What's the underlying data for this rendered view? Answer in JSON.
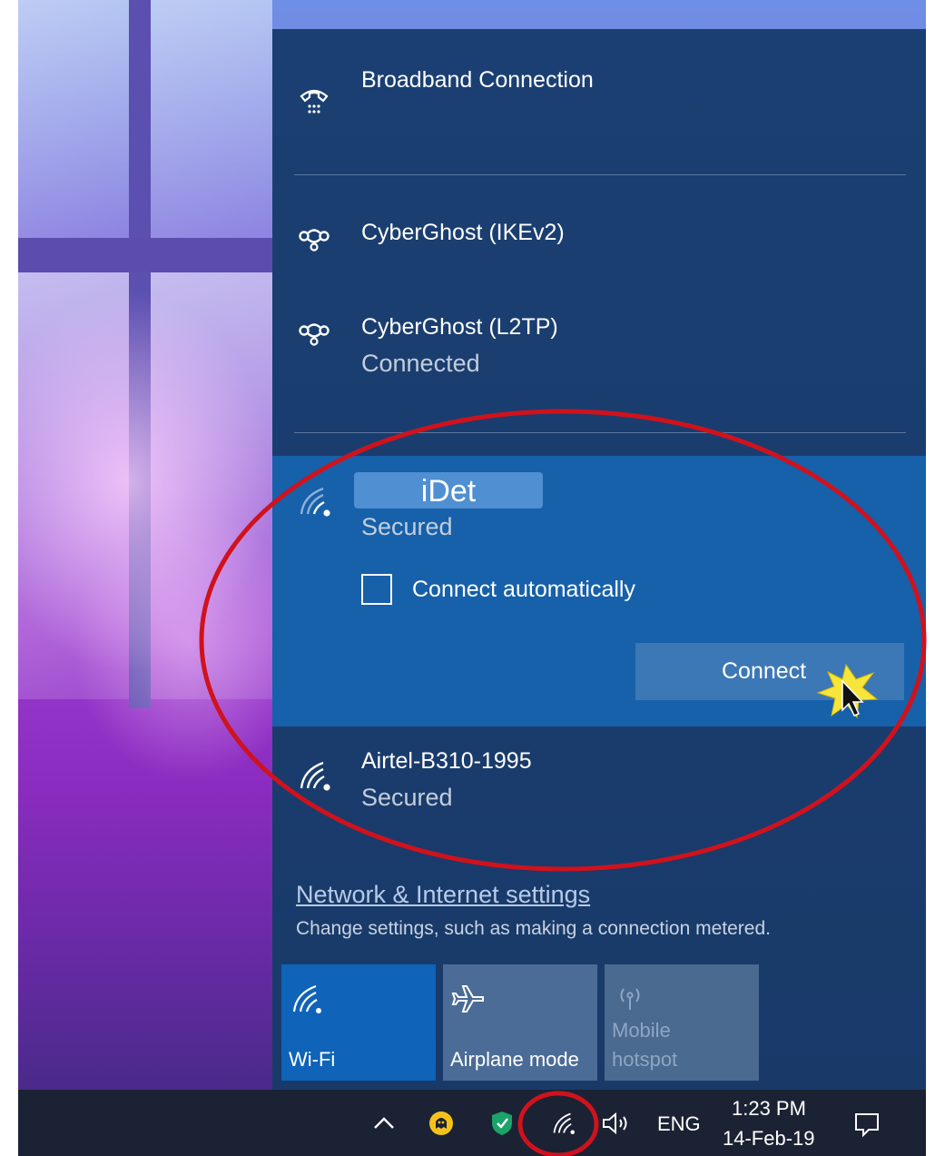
{
  "flyout": {
    "connections": [
      {
        "name": "Broadband Connection",
        "icon": "dialup-icon"
      },
      {
        "name": "CyberGhost (IKEv2)",
        "icon": "vpn-icon"
      },
      {
        "name": "CyberGhost (L2TP)",
        "status": "Connected",
        "icon": "vpn-icon"
      }
    ],
    "selected_network": {
      "name": "iDet",
      "status": "Secured",
      "auto_connect_label": "Connect automatically",
      "auto_connect_checked": false,
      "connect_label": "Connect",
      "icon": "wifi-signal-icon"
    },
    "other_networks": [
      {
        "name": "Airtel-B310-1995",
        "status": "Secured",
        "icon": "wifi-signal-icon"
      }
    ],
    "settings": {
      "link": "Network & Internet settings",
      "description": "Change settings, such as making a connection metered."
    },
    "quick_actions": [
      {
        "label": "Wi-Fi",
        "icon": "wifi-icon",
        "state": "on"
      },
      {
        "label": "Airplane mode",
        "icon": "airplane-icon",
        "state": "off"
      },
      {
        "label_line1": "Mobile",
        "label_line2": "hotspot",
        "icon": "hotspot-icon",
        "state": "disabled"
      }
    ]
  },
  "taskbar": {
    "tray_icons": [
      "chevron-up-icon",
      "cyberghost-icon",
      "security-shield-icon",
      "wifi-icon",
      "speaker-icon"
    ],
    "language": "ENG",
    "time": "1:23 PM",
    "date": "14-Feb-19",
    "action_center_icon": "notification-icon"
  },
  "colors": {
    "flyout_bg": "#1b3f72",
    "selected_bg": "#1760aa",
    "tile_on": "#0f63b8",
    "tile_off": "#4a6c96",
    "annotation_red": "#d0121c",
    "taskbar_bg": "#1b2233"
  }
}
